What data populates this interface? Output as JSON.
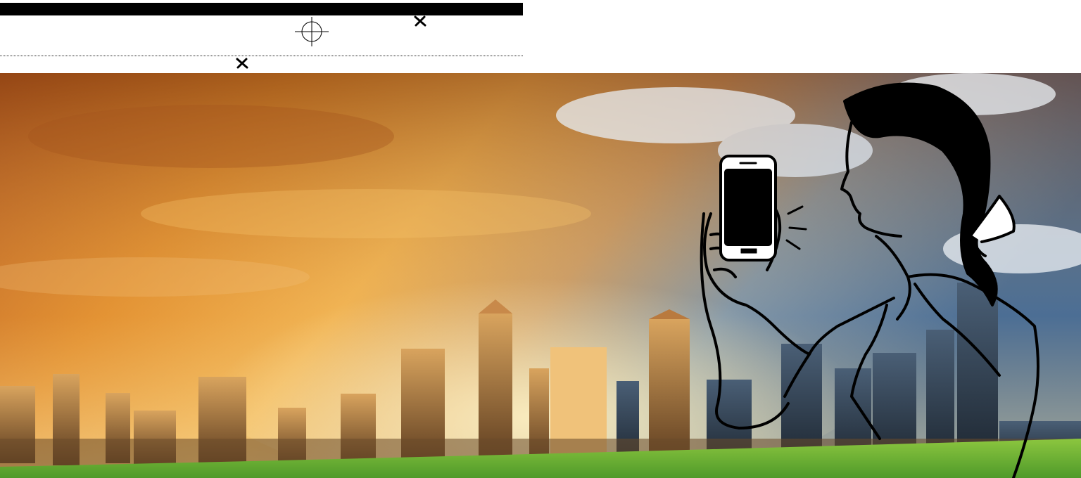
{
  "print_marks": {
    "top_bar": "black-bar",
    "registration": "crosshair-icon",
    "cut_marks": [
      "x-mark-icon",
      "x-mark-icon"
    ],
    "rule": "dotted-rule"
  },
  "scene": {
    "subject": "woman-with-smartphone-line-art",
    "background": "city-skyline-sunset",
    "colors": {
      "sky_warm": "#e08a2a",
      "sky_deep": "#a8561a",
      "sky_blue": "#3d6ea8",
      "cloud": "#e9eef3",
      "grass": "#6fb33a",
      "line": "#000000"
    }
  }
}
